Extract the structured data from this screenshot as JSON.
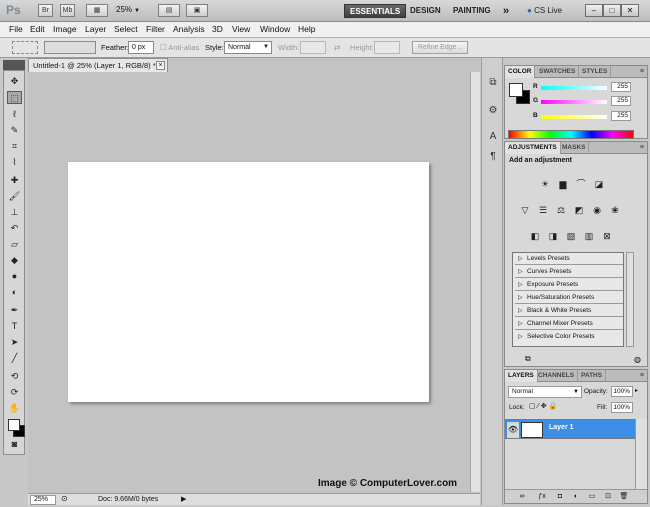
{
  "app": {
    "logo": "Ps"
  },
  "appbar": {
    "icons": [
      {
        "name": "br",
        "label": "Br"
      },
      {
        "name": "mb",
        "label": "Mb"
      },
      {
        "name": "view-extras",
        "label": "▦"
      },
      {
        "name": "arrange",
        "label": "▤"
      },
      {
        "name": "screen-mode",
        "label": "▣"
      }
    ],
    "zoom": "25%",
    "workspaces": [
      "ESSENTIALS",
      "DESIGN",
      "PAINTING"
    ],
    "more": "»",
    "cs_live": "CS Live",
    "window_controls": [
      "–",
      "□",
      "✕"
    ]
  },
  "menu": [
    "File",
    "Edit",
    "Image",
    "Layer",
    "Select",
    "Filter",
    "Analysis",
    "3D",
    "View",
    "Window",
    "Help"
  ],
  "options": {
    "feather_label": "Feather:",
    "feather_value": "0 px",
    "anti_alias": "Anti-alias",
    "style_label": "Style:",
    "style_value": "Normal",
    "width_label": "Width:",
    "height_label": "Height:",
    "refine_edge": "Refine Edge..."
  },
  "document": {
    "tab_title": "Untitled-1 @ 25% (Layer 1, RGB/8) *",
    "close": "×",
    "watermark": "Image © ComputerLover.com"
  },
  "status": {
    "zoom": "25%",
    "doc_info": "Doc: 9.66M/0 bytes"
  },
  "color_panel": {
    "tabs": [
      "COLOR",
      "SWATCHES",
      "STYLES"
    ],
    "channels": [
      {
        "label": "R",
        "value": "255"
      },
      {
        "label": "G",
        "value": "255"
      },
      {
        "label": "B",
        "value": "255"
      }
    ]
  },
  "adjustments": {
    "tabs": [
      "ADJUSTMENTS",
      "MASKS"
    ],
    "title": "Add an adjustment",
    "presets": [
      "Levels Presets",
      "Curves Presets",
      "Exposure Presets",
      "Hue/Saturation Presets",
      "Black & White Presets",
      "Channel Mixer Presets",
      "Selective Color Presets"
    ]
  },
  "layers": {
    "tabs": [
      "LAYERS",
      "CHANNELS",
      "PATHS"
    ],
    "blend_mode": "Normal",
    "opacity_label": "Opacity:",
    "opacity": "100%",
    "lock_label": "Lock:",
    "fill_label": "Fill:",
    "fill": "100%",
    "layer_name": "Layer 1"
  },
  "colors": {
    "accent": "#3d8ee6",
    "workspace_bg": "#c3c3c3"
  }
}
